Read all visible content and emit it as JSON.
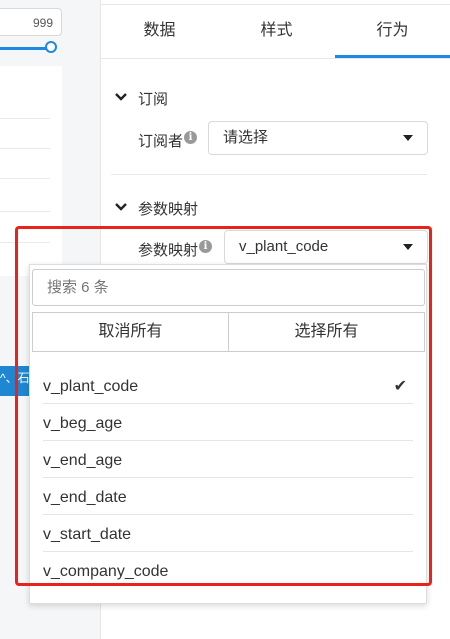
{
  "left": {
    "number_value": "999",
    "strip_text": "^、石"
  },
  "tabs": [
    {
      "label": "数据"
    },
    {
      "label": "样式"
    },
    {
      "label": "行为"
    }
  ],
  "subscribe": {
    "section_title": "订阅",
    "label": "订阅者",
    "select_value": "请选择"
  },
  "mapping": {
    "section_title": "参数映射",
    "label": "参数映射",
    "select_value": "v_plant_code"
  },
  "dropdown": {
    "search_placeholder": "搜索 6 条",
    "deselect_all": "取消所有",
    "select_all": "选择所有",
    "options": [
      {
        "label": "v_plant_code",
        "selected": true
      },
      {
        "label": "v_beg_age",
        "selected": false
      },
      {
        "label": "v_end_age",
        "selected": false
      },
      {
        "label": "v_end_date",
        "selected": false
      },
      {
        "label": "v_start_date",
        "selected": false
      },
      {
        "label": "v_company_code",
        "selected": false
      }
    ]
  },
  "icons": {
    "info": "info-icon",
    "chevron": "chevron-down-icon",
    "caret": "caret-down-icon",
    "check": "checkmark-icon"
  },
  "colors": {
    "accent": "#1e88e5",
    "highlight_frame": "#e8231b"
  }
}
